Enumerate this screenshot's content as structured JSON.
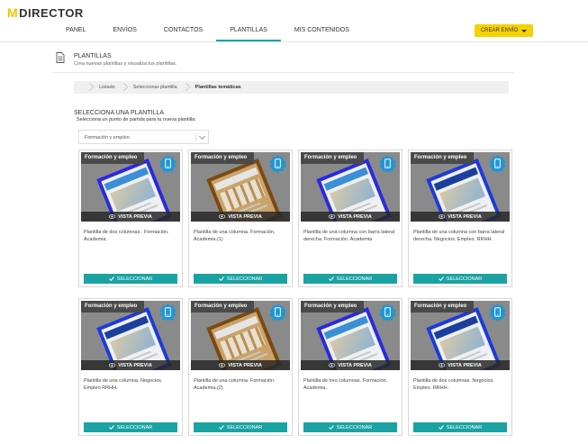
{
  "brand": {
    "logo_text": "DIRECTOR",
    "logo_mark": "M"
  },
  "nav": {
    "tabs": [
      {
        "label": "PANEL",
        "active": false
      },
      {
        "label": "ENVÍOS",
        "active": false
      },
      {
        "label": "CONTACTOS",
        "active": false
      },
      {
        "label": "PLANTILLAS",
        "active": true
      },
      {
        "label": "MIS CONTENIDOS",
        "active": false
      }
    ],
    "create_button": "CREAR ENVÍO"
  },
  "page": {
    "title": "PLANTILLAS",
    "subtitle": "Crea nuevas plantillas y visualiza tus plantillas."
  },
  "breadcrumb": [
    "Listado",
    "Seleccionar plantilla",
    "Plantillas temáticas"
  ],
  "selection": {
    "title": "SELECCIONA UNA PLANTILLA",
    "subtitle": "Selecciona un punto de partida para tu nueva plantilla:",
    "dropdown_value": "Formación y empleo"
  },
  "cards": [
    {
      "category": "Formación y empleo",
      "preview": "VISTA PREVIA",
      "description": "Plantilla de dos columnas . Formación. Academia.",
      "select": "SELECCIONAR"
    },
    {
      "category": "Formación y empleo",
      "preview": "VISTA PREVIA",
      "description": "Plantilla de una columna. Formación. Academia.(1)",
      "select": "SELECCIONAR"
    },
    {
      "category": "Formación y empleo",
      "preview": "VISTA PREVIA",
      "description": "Plantilla de una columna con barra lateral derecha. Formación. Academia",
      "select": "SELECCIONAR"
    },
    {
      "category": "Formación y empleo",
      "preview": "VISTA PREVIA",
      "description": "Plantilla de una columna con barra lateral derecha. Negocios. Empleo. RRHH.",
      "select": "SELECCIONAR"
    },
    {
      "category": "Formación y empleo",
      "preview": "VISTA PREVIA",
      "description": "Plantilla de una columna. Negocios. Empleo RRHH.",
      "select": "SELECCIONAR"
    },
    {
      "category": "Formación y empleo",
      "preview": "VISTA PREVIA",
      "description": "Plantilla de una columna. Formación. Academia.(2)",
      "select": "SELECCIONAR"
    },
    {
      "category": "Formación y empleo",
      "preview": "VISTA PREVIA",
      "description": "Plantilla de tres columnas. Formación. Academia.",
      "select": "SELECCIONAR"
    },
    {
      "category": "Formación y empleo",
      "preview": "VISTA PREVIA",
      "description": "Plantilla de dos columnas. Negocios. Empleo. RRHH.",
      "select": "SELECCIONAR"
    }
  ],
  "colors": {
    "accent": "#1ba3a3",
    "create_button": "#f5d100",
    "mockup_border": "#2a2adc"
  }
}
